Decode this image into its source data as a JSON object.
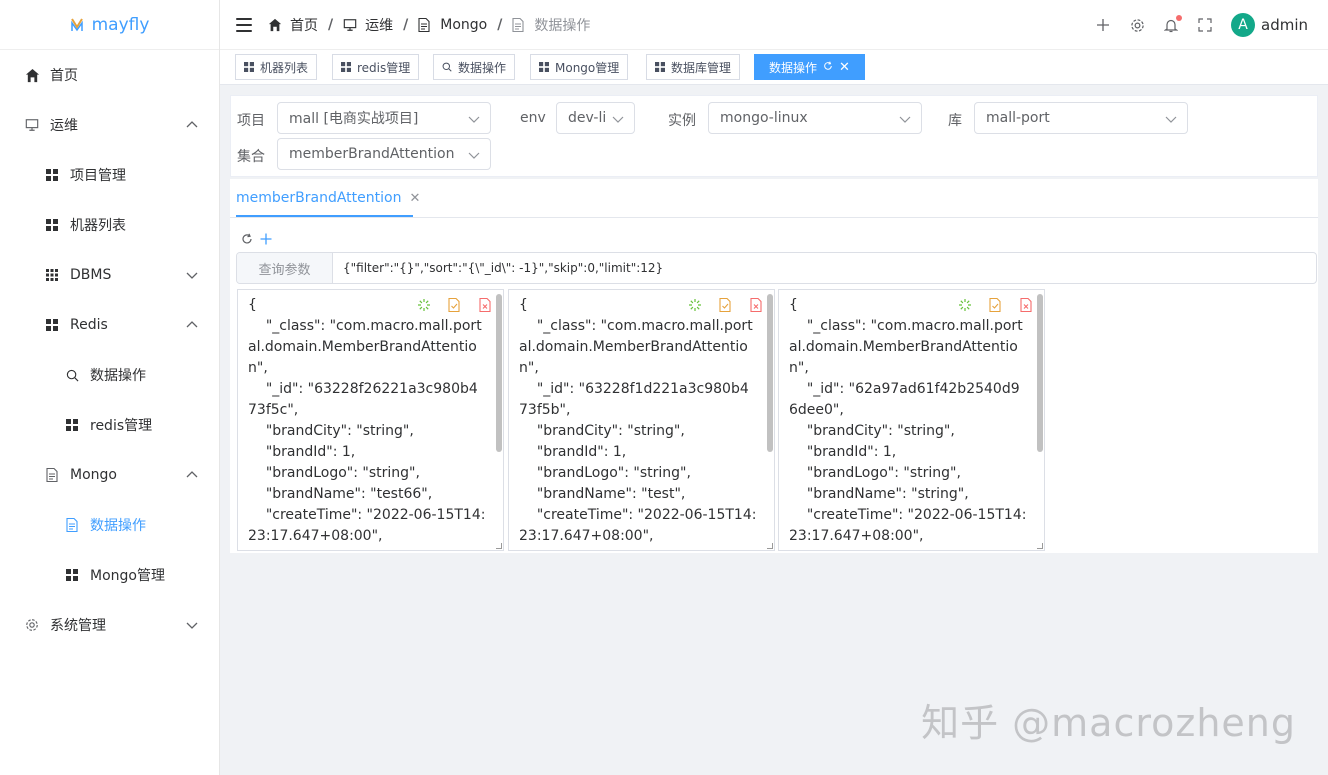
{
  "app": {
    "name": "mayfly"
  },
  "sidebar": {
    "items": [
      {
        "label": "首页",
        "icon": "home-icon"
      },
      {
        "label": "运维",
        "icon": "monitor-icon"
      },
      {
        "label": "项目管理",
        "icon": "grid-icon"
      },
      {
        "label": "机器列表",
        "icon": "grid-icon"
      },
      {
        "label": "DBMS",
        "icon": "grid-icon"
      },
      {
        "label": "Redis",
        "icon": "grid-icon"
      },
      {
        "label": "数据操作",
        "icon": "search-icon"
      },
      {
        "label": "redis管理",
        "icon": "grid-icon"
      },
      {
        "label": "Mongo",
        "icon": "document-icon"
      },
      {
        "label": "数据操作",
        "icon": "document-icon"
      },
      {
        "label": "Mongo管理",
        "icon": "grid-icon"
      },
      {
        "label": "系统管理",
        "icon": "gear-icon"
      }
    ]
  },
  "header": {
    "breadcrumb": [
      "首页",
      "运维",
      "Mongo",
      "数据操作"
    ],
    "user": {
      "initial": "A",
      "name": "admin"
    }
  },
  "tags": [
    "机器列表",
    "redis管理",
    "数据操作",
    "Mongo管理",
    "数据库管理",
    "数据操作"
  ],
  "form": {
    "project_label": "项目",
    "project_value": "mall [电商实战项目]",
    "env_label": "env",
    "env_value": "dev-lii",
    "instance_label": "实例",
    "instance_value": "mongo-linux",
    "db_label": "库",
    "db_value": "mall-port",
    "collection_label": "集合",
    "collection_value": "memberBrandAttention"
  },
  "collection_tab": {
    "label": "memberBrandAttention"
  },
  "query": {
    "label": "查询参数",
    "value": "{\"filter\":\"{}\",\"sort\":\"{\\\"_id\\\": -1}\",\"skip\":0,\"limit\":12}"
  },
  "documents": [
    "{\n    \"_class\": \"com.macro.mall.portal.domain.MemberBrandAttention\",\n    \"_id\": \"63228f26221a3c980b473f5c\",\n    \"brandCity\": \"string\",\n    \"brandId\": 1,\n    \"brandLogo\": \"string\",\n    \"brandName\": \"test66\",\n    \"createTime\": \"2022-06-15T14:23:17.647+08:00\",",
    "{\n    \"_class\": \"com.macro.mall.portal.domain.MemberBrandAttention\",\n    \"_id\": \"63228f1d221a3c980b473f5b\",\n    \"brandCity\": \"string\",\n    \"brandId\": 1,\n    \"brandLogo\": \"string\",\n    \"brandName\": \"test\",\n    \"createTime\": \"2022-06-15T14:23:17.647+08:00\",",
    "{\n    \"_class\": \"com.macro.mall.portal.domain.MemberBrandAttention\",\n    \"_id\": \"62a97ad61f42b2540d96dee0\",\n    \"brandCity\": \"string\",\n    \"brandId\": 1,\n    \"brandLogo\": \"string\",\n    \"brandName\": \"string\",\n    \"createTime\": \"2022-06-15T14:23:17.647+08:00\","
  ],
  "watermark": "知乎 @macrozheng",
  "colors": {
    "accent": "#409eff",
    "avatar": "#13a889",
    "badge": "#f56c6c"
  }
}
